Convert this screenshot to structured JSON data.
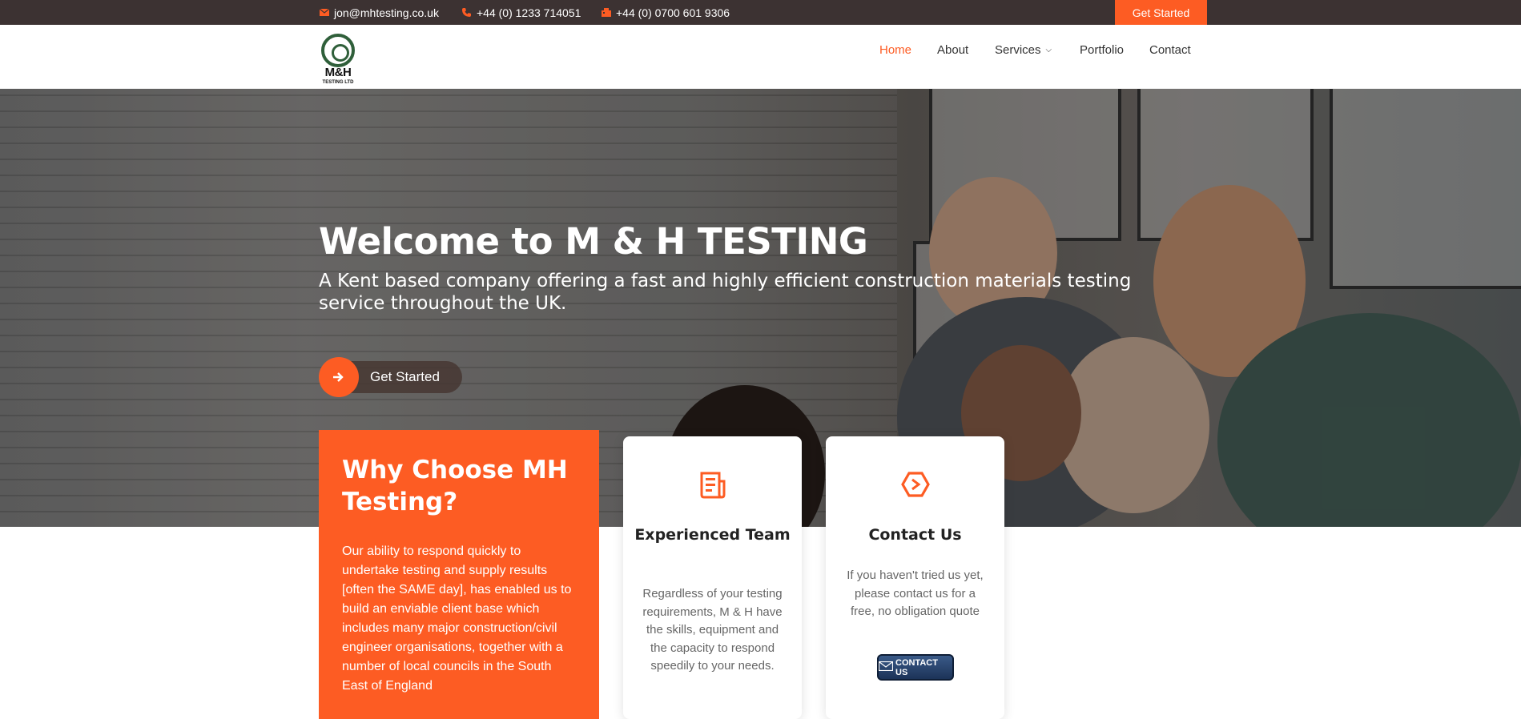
{
  "topbar": {
    "email": "jon@mhtesting.co.uk",
    "phone": "+44 (0) 1233 714051",
    "fax": "+44 (0) 0700 601 9306",
    "cta_label": "Get Started"
  },
  "brand": {
    "logo_text": "M&H",
    "logo_subtext": "TESTING LTD",
    "color_accent": "#fd5c23",
    "color_dark": "#3c3232"
  },
  "nav": {
    "items": [
      {
        "label": "Home",
        "active": true
      },
      {
        "label": "About",
        "active": false
      },
      {
        "label": "Services",
        "active": false
      },
      {
        "label": "Portfolio",
        "active": false
      },
      {
        "label": "Contact",
        "active": false
      }
    ]
  },
  "hero": {
    "title": "Welcome to M & H TESTING",
    "subtitle": "A Kent based company offering a fast and highly efficient construction materials testing service throughout the UK.",
    "button_label": "Get Started"
  },
  "why": {
    "title": "Why Choose MH Testing?",
    "body": "Our ability to respond quickly to undertake testing and supply results [often the SAME day], has enabled us to build an enviable client base which includes many major construction/civil engineer organisations, together with a number of local councils in the South East of England"
  },
  "cards": [
    {
      "icon": "document-icon",
      "title": "Experienced Team",
      "body": "Regardless of your testing requirements, M & H have the skills, equipment and the capacity to respond speedily to your needs."
    },
    {
      "icon": "hexagon-icon",
      "title": "Contact Us",
      "body": "If you haven't tried us yet, please contact us for a free, no obligation quote",
      "button_label": "CONTACT US"
    }
  ]
}
